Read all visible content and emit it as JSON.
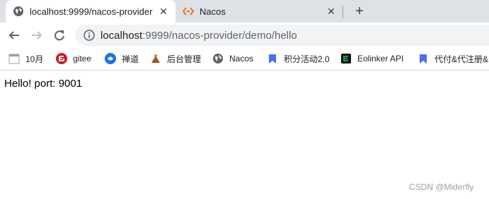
{
  "tabs": [
    {
      "title": "localhost:9999/nacos-provider",
      "active": true
    },
    {
      "title": "Nacos",
      "active": false
    }
  ],
  "toolbar": {
    "url_host": "localhost",
    "url_rest": ":9999/nacos-provider/demo/hello"
  },
  "bookmarks": [
    {
      "label": "10月",
      "icon": "calendar-icon"
    },
    {
      "label": "gitee",
      "icon": "gitee-icon"
    },
    {
      "label": "禅道",
      "icon": "zentao-icon"
    },
    {
      "label": "后台管理",
      "icon": "admin-icon"
    },
    {
      "label": "Nacos",
      "icon": "globe-icon"
    },
    {
      "label": "积分活动2.0",
      "icon": "bookmark-icon"
    },
    {
      "label": "Eolinker API",
      "icon": "eolinker-icon"
    },
    {
      "label": "代付&代注册&",
      "icon": "bookmark-icon"
    }
  ],
  "page": {
    "body_text": "Hello! port: 9001",
    "watermark": "CSDN @Miderfly"
  },
  "colors": {
    "tabstrip": "#dee1e6",
    "nacos_orange": "#f2711c",
    "gitee_red": "#c71d23",
    "eolinker_green": "#1b9c4e"
  }
}
